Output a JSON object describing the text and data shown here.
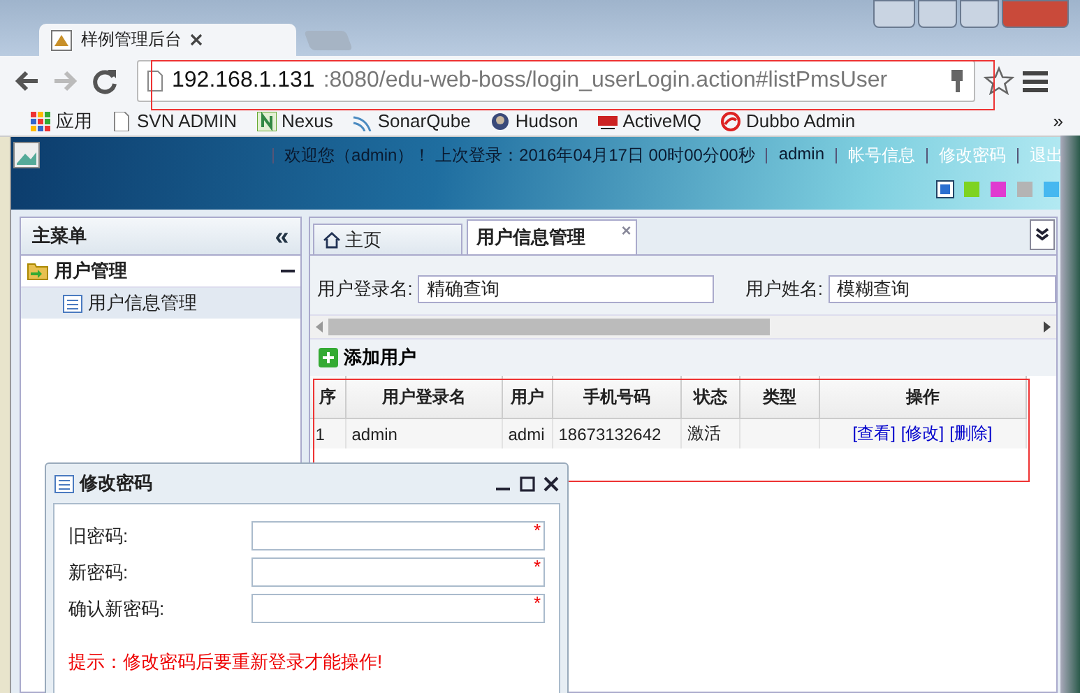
{
  "browser": {
    "tab_title": "样例管理后台",
    "url": {
      "host": "192.168.1.131",
      "path": ":8080/edu-web-boss/login_userLogin.action#listPmsUser"
    },
    "bookmarks": [
      {
        "label": "应用",
        "kind": "apps"
      },
      {
        "label": "SVN ADMIN",
        "kind": "page"
      },
      {
        "label": "Nexus",
        "kind": "nexus"
      },
      {
        "label": "SonarQube",
        "kind": "sonar"
      },
      {
        "label": "Hudson",
        "kind": "hudson"
      },
      {
        "label": "ActiveMQ",
        "kind": "amq"
      },
      {
        "label": "Dubbo Admin",
        "kind": "dubbo"
      }
    ],
    "more_bookmarks": "»"
  },
  "header": {
    "welcome": "欢迎您（admin）！ 上次登录：2016年04月17日 00时00分00秒",
    "user": "admin",
    "links": [
      "帐号信息",
      "修改密码",
      "退出"
    ],
    "themes": [
      {
        "color": "#2a6fd0",
        "selected": true
      },
      {
        "color": "#7ed321",
        "selected": false
      },
      {
        "color": "#e03ad0",
        "selected": false
      },
      {
        "color": "#b4b4b4",
        "selected": false
      },
      {
        "color": "#46b8f0",
        "selected": false
      }
    ]
  },
  "sidebar": {
    "title": "主菜单",
    "collapse": "«",
    "items": [
      {
        "label": "用户管理",
        "expanded": true,
        "children": [
          {
            "label": "用户信息管理",
            "selected": true
          }
        ]
      }
    ]
  },
  "tabs": [
    {
      "label": "主页",
      "kind": "home",
      "selected": false,
      "closable": false
    },
    {
      "label": "用户信息管理",
      "kind": "page",
      "selected": true,
      "closable": true
    }
  ],
  "tab_close": "×",
  "search": [
    {
      "label": "用户登录名:",
      "value": "精确查询"
    },
    {
      "label": "用户姓名:",
      "value": "模糊查询"
    }
  ],
  "toolbar": {
    "add": "添加用户"
  },
  "table": {
    "columns": [
      "序",
      "用户登录名",
      "用户",
      "手机号码",
      "状态",
      "类型",
      "操作"
    ],
    "rows": [
      {
        "cells": [
          "1",
          "admin",
          "admi",
          "18673132642",
          "激活",
          ""
        ],
        "actions": [
          "[查看]",
          "[修改]",
          "[删除]"
        ]
      }
    ]
  },
  "dialog": {
    "title": "修改密码",
    "fields": [
      {
        "label": "旧密码:",
        "required": true
      },
      {
        "label": "新密码:",
        "required": true
      },
      {
        "label": "确认新密码:",
        "required": true
      }
    ],
    "required_mark": "*",
    "hint": "提示：修改密码后要重新登录才能操作!"
  }
}
